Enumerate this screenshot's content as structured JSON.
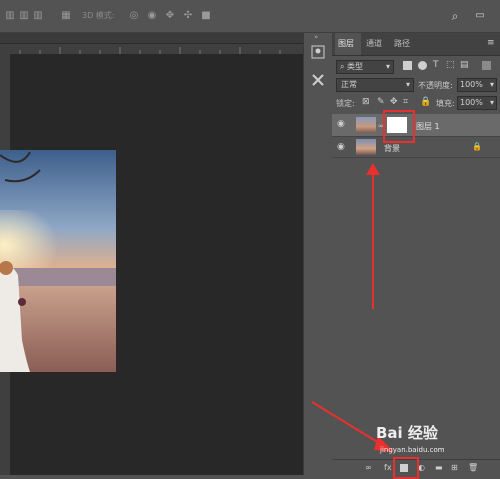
{
  "optbar": {
    "mode_3d_label": "3D 模式:",
    "icons": [
      "align-icon",
      "align-icon",
      "align-icon",
      "align-icon",
      "distribute-icon",
      "rotate-3d-icon",
      "roll-3d-icon",
      "drag-3d-icon",
      "slide-3d-icon",
      "scale-3d-icon",
      "search-icon",
      "workspace-icon"
    ]
  },
  "panel": {
    "tabs": [
      {
        "label": "图层",
        "active": true
      },
      {
        "label": "通道",
        "active": false
      },
      {
        "label": "路径",
        "active": false
      }
    ],
    "filter_label": "类型",
    "blend_mode": "正常",
    "opacity_label": "不透明度:",
    "opacity_value": "100%",
    "lock_label": "锁定:",
    "fill_label": "填充:",
    "fill_value": "100%",
    "layers": [
      {
        "name": "图层 1",
        "selected": true
      },
      {
        "name": "背景",
        "selected": false
      }
    ],
    "bottom_icons": [
      "link-icon",
      "fx-icon",
      "add-mask-icon",
      "adjustment-icon",
      "group-icon",
      "new-layer-icon",
      "trash-icon"
    ],
    "bottom_fx": "fx"
  },
  "colors": {
    "annotation_red": "#e8312f",
    "panel_bg": "#535353",
    "canvas_bg": "#282828"
  },
  "watermark": {
    "text": "Bai 经验",
    "sub": "jingyan.baidu.com"
  }
}
